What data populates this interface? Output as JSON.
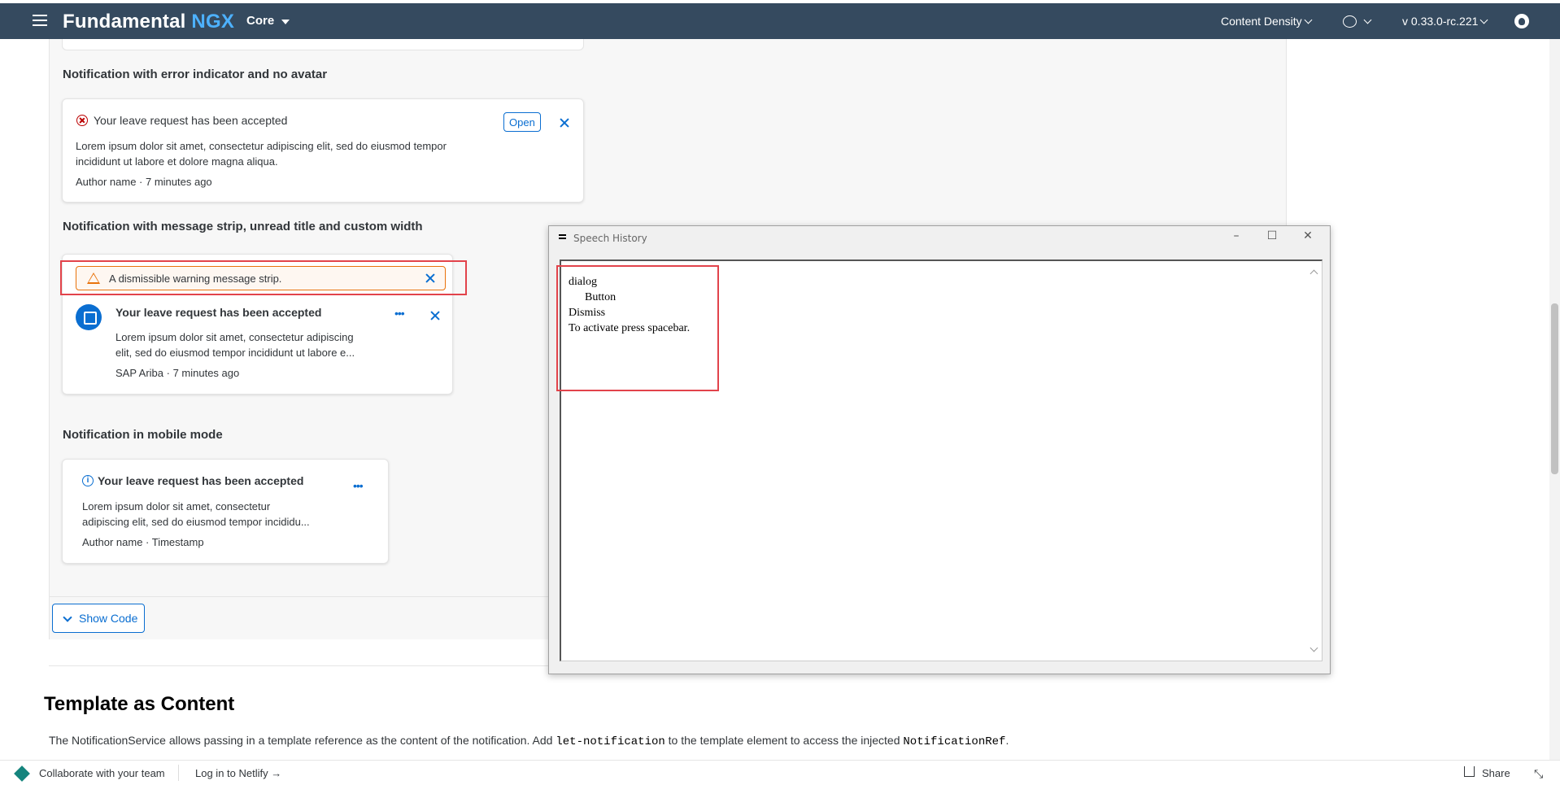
{
  "topbar": {
    "brand_main": "Fundamental",
    "brand_accent": "NGX",
    "core_label": "Core",
    "content_density_label": "Content Density",
    "version_label": "v 0.33.0-rc.221"
  },
  "sections": {
    "error_heading": "Notification with error indicator and no avatar",
    "strip_heading": "Notification with message strip, unread title and custom width",
    "mobile_heading": "Notification in mobile mode"
  },
  "error_notification": {
    "title": "Your leave request has been accepted",
    "body_line1": "Lorem ipsum dolor sit amet, consectetur adipiscing elit, sed do eiusmod tempor",
    "body_line2": "incididunt ut labore et dolore magna aliqua.",
    "footer": "Author name  ·  7 minutes ago",
    "open_label": "Open"
  },
  "strip_notification": {
    "strip_text": "A dismissible warning message strip.",
    "title": "Your leave request has been accepted",
    "body_line1": "Lorem ipsum dolor sit amet, consectetur adipiscing",
    "body_line2": "elit, sed do eiusmod tempor incididunt ut labore e...",
    "footer": "SAP Ariba  ·  7 minutes ago"
  },
  "mobile_notification": {
    "title": "Your leave request has been accepted",
    "body_line1": "Lorem ipsum dolor sit amet, consectetur",
    "body_line2": "adipiscing elit, sed do eiusmod tempor incididu...",
    "footer": "Author name  ·  Timestamp"
  },
  "show_code_label": "Show Code",
  "template_section": {
    "heading": "Template as Content",
    "text_part1": "The NotificationService allows passing in a template reference as the content of the notification. Add ",
    "code1": "let-notification",
    "text_part2": " to the template element to access the injected ",
    "code2": "NotificationRef",
    "text_part3": "."
  },
  "bottombar": {
    "collaborate_label": "Collaborate with your team",
    "login_label": "Log in to Netlify →",
    "share_label": "Share"
  },
  "speech_dialog": {
    "title": "Speech History",
    "lines": [
      "dialog",
      "Button",
      "Dismiss",
      "To activate press spacebar."
    ]
  },
  "colors": {
    "shell": "#354a5f",
    "accent": "#0a6ed1",
    "error": "#bb0000",
    "warning": "#e9730c",
    "highlight_box": "#e2434b"
  }
}
